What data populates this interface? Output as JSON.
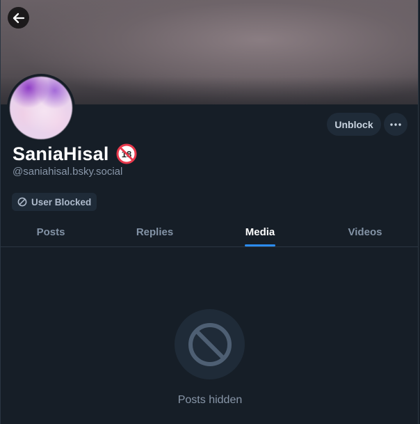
{
  "profile": {
    "display_name": "SaniaHisal",
    "handle": "@saniahisal.bsky.social",
    "blocked_label": "User Blocked"
  },
  "actions": {
    "unblock_label": "Unblock"
  },
  "tabs": [
    {
      "label": "Posts",
      "active": false
    },
    {
      "label": "Replies",
      "active": false
    },
    {
      "label": "Media",
      "active": true
    },
    {
      "label": "Videos",
      "active": false
    }
  ],
  "empty_state": {
    "message": "Posts hidden"
  },
  "colors": {
    "background": "#161e27",
    "button_bg": "#1f2b38",
    "accent": "#2b8cf0",
    "adult_badge": "#e8394c"
  },
  "icons": {
    "back": "arrow-left-icon",
    "more": "ellipsis-icon",
    "blocked": "block-icon",
    "adult": "no-under-18-icon",
    "hidden": "prohibited-icon"
  }
}
